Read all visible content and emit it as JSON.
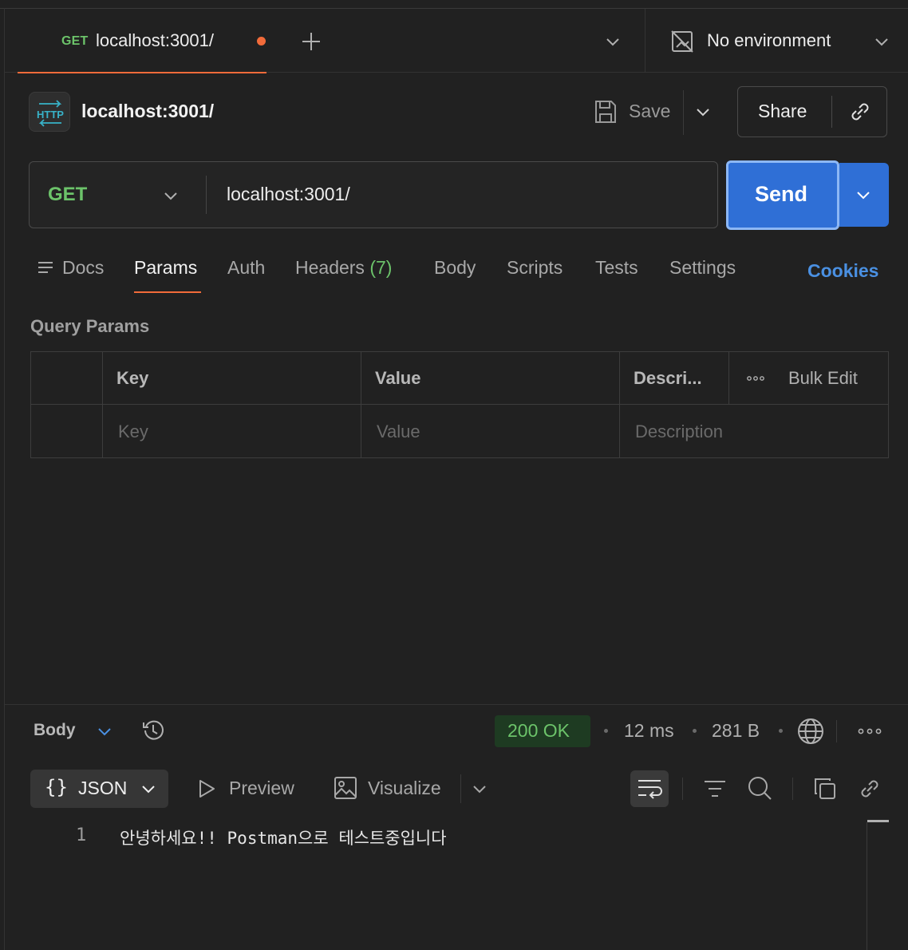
{
  "tab": {
    "method": "GET",
    "title": "localhost:3001/"
  },
  "environment": {
    "label": "No environment"
  },
  "request": {
    "title": "localhost:3001/",
    "save_label": "Save",
    "share_label": "Share",
    "method": "GET",
    "url": "localhost:3001/",
    "send_label": "Send"
  },
  "request_tabs": {
    "docs": "Docs",
    "params": "Params",
    "auth": "Auth",
    "headers": "Headers",
    "headers_count": "(7)",
    "body": "Body",
    "scripts": "Scripts",
    "tests": "Tests",
    "settings": "Settings",
    "cookies": "Cookies"
  },
  "query_params": {
    "title": "Query Params",
    "columns": {
      "key": "Key",
      "value": "Value",
      "description": "Descri..."
    },
    "bulk_edit": "Bulk Edit",
    "placeholders": {
      "key": "Key",
      "value": "Value",
      "description": "Description"
    }
  },
  "response": {
    "body_label": "Body",
    "status": "200 OK",
    "time": "12 ms",
    "size": "281 B",
    "format": "JSON",
    "braces": "{}",
    "preview": "Preview",
    "visualize": "Visualize",
    "lines": [
      {
        "no": "1",
        "text": "안녕하세요!! Postman으로 테스트중입니다"
      }
    ]
  },
  "colors": {
    "accent": "#f26b3a",
    "method_get": "#6cc36a",
    "send": "#2f6fd6",
    "link": "#4a90e2"
  }
}
